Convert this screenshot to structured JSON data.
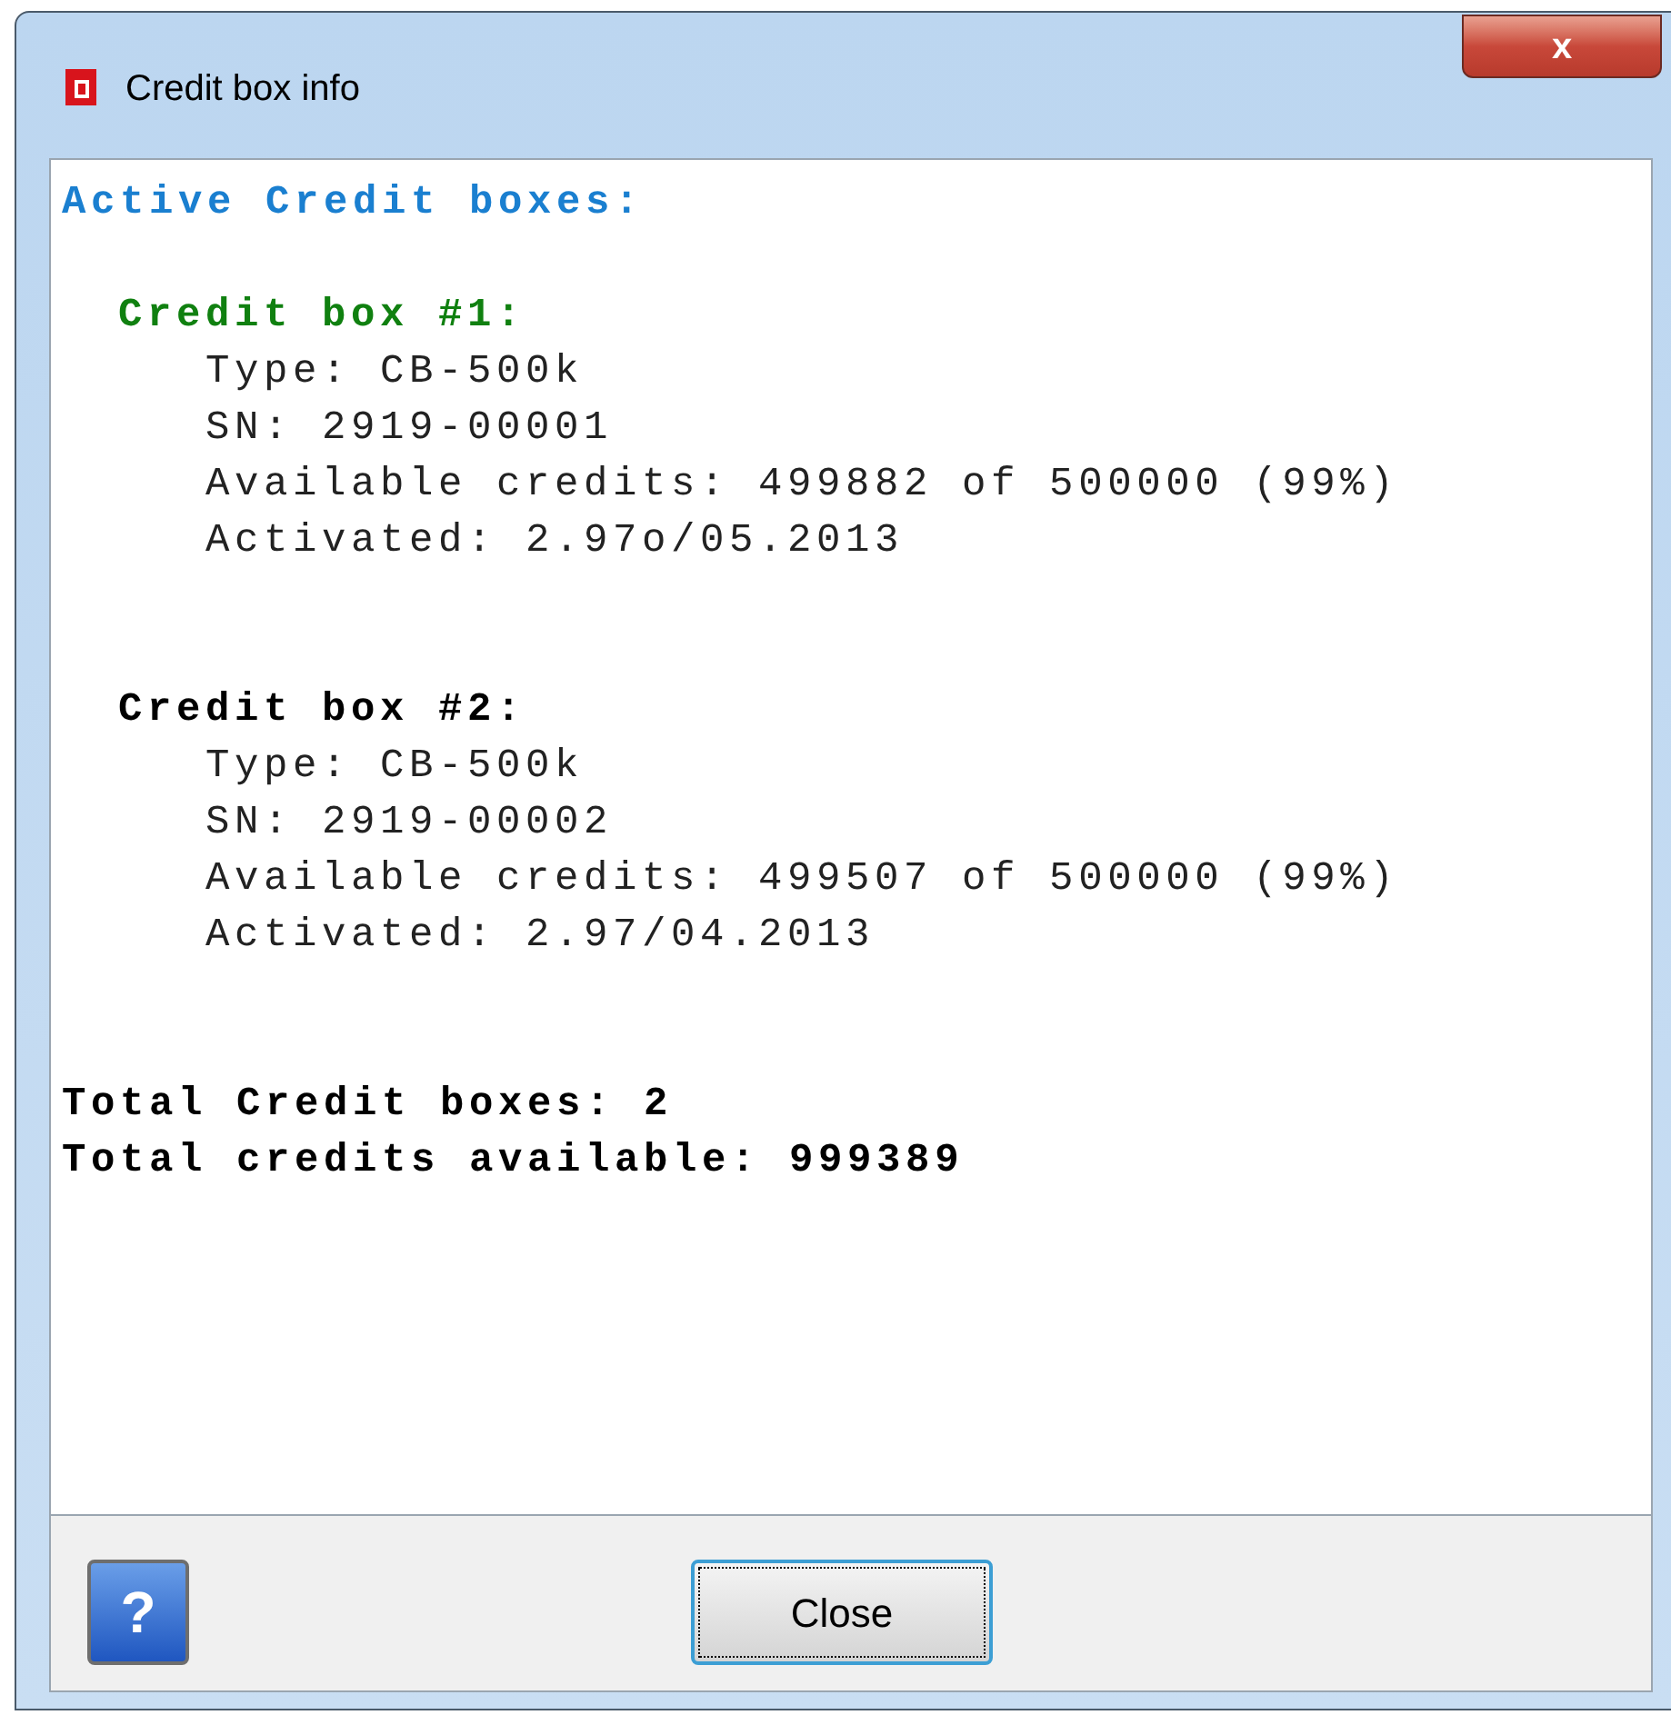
{
  "window": {
    "title": "Credit box info",
    "close_glyph": "x"
  },
  "report": {
    "heading": "Active Credit boxes:",
    "boxes": [
      {
        "title": "Credit box #1:",
        "color": "#108010",
        "lines": [
          "Type: CB-500k",
          "SN: 2919-00001",
          "Available credits: 499882 of 500000 (99%)",
          "Activated: 2.97o/05.2013"
        ]
      },
      {
        "title": "Credit box #2:",
        "color": "#000000",
        "lines": [
          "Type: CB-500k",
          "SN: 2919-00002",
          "Available credits: 499507 of 500000 (99%)",
          "Activated: 2.97/04.2013"
        ]
      }
    ],
    "totals": [
      "Total Credit boxes: 2",
      "Total credits available: 999389"
    ]
  },
  "footer": {
    "help_glyph": "?",
    "button": "Close"
  }
}
